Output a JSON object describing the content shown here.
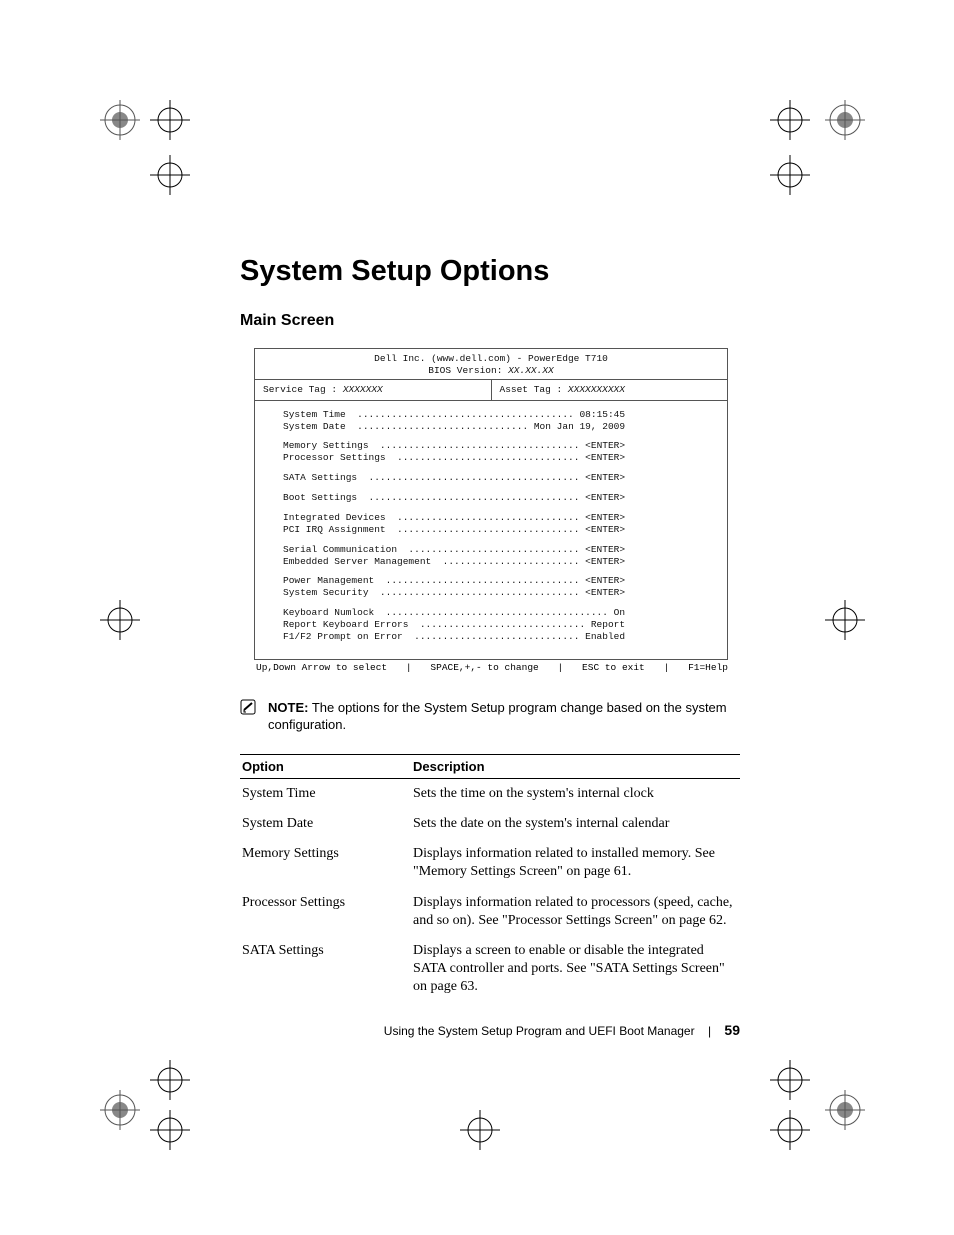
{
  "heading": "System Setup Options",
  "subheading": "Main Screen",
  "bios": {
    "header_line1": "Dell Inc. (www.dell.com) - PowerEdge T710",
    "header_line2_pre": "BIOS Version: ",
    "header_line2_ital": "XX.XX.XX",
    "service_tag_label": "Service Tag : ",
    "service_tag_value": "XXXXXXX",
    "asset_tag_label": "Asset Tag : ",
    "asset_tag_value": "XXXXXXXXXX",
    "groups": [
      [
        {
          "label": "System Time",
          "value": "08:15:45"
        },
        {
          "label": "System Date",
          "value": "Mon Jan 19, 2009"
        }
      ],
      [
        {
          "label": "Memory Settings",
          "value": "<ENTER>"
        },
        {
          "label": "Processor Settings",
          "value": "<ENTER>"
        }
      ],
      [
        {
          "label": "SATA Settings",
          "value": "<ENTER>"
        }
      ],
      [
        {
          "label": "Boot Settings",
          "value": "<ENTER>"
        }
      ],
      [
        {
          "label": "Integrated Devices",
          "value": "<ENTER>"
        },
        {
          "label": "PCI IRQ Assignment",
          "value": "<ENTER>"
        }
      ],
      [
        {
          "label": "Serial Communication",
          "value": "<ENTER>"
        },
        {
          "label": "Embedded Server Management",
          "value": "<ENTER>"
        }
      ],
      [
        {
          "label": "Power Management",
          "value": "<ENTER>"
        },
        {
          "label": "System Security",
          "value": "<ENTER>"
        }
      ],
      [
        {
          "label": "Keyboard Numlock",
          "value": "On"
        },
        {
          "label": "Report Keyboard Errors",
          "value": "Report"
        },
        {
          "label": "F1/F2 Prompt on Error",
          "value": "Enabled"
        }
      ]
    ],
    "footer": {
      "a": "Up,Down Arrow to select",
      "b": "SPACE,+,- to change",
      "c": "ESC to exit",
      "d": "F1=Help"
    }
  },
  "note": {
    "label": "NOTE:",
    "text": " The options for the System Setup program change based on the system configuration."
  },
  "table": {
    "col_option": "Option",
    "col_description": "Description",
    "rows": [
      {
        "option": "System Time",
        "description": "Sets the time on the system's internal clock"
      },
      {
        "option": "System Date",
        "description": "Sets the date on the system's internal calendar"
      },
      {
        "option": "Memory Settings",
        "description": "Displays information related to installed memory. See \"Memory Settings Screen\" on page 61."
      },
      {
        "option": "Processor Settings",
        "description": "Displays information related to processors (speed, cache, and so on). See \"Processor Settings Screen\" on page 62."
      },
      {
        "option": "SATA Settings",
        "description": "Displays a screen to enable or disable the integrated SATA controller and ports. See \"SATA Settings Screen\" on page 63."
      }
    ]
  },
  "footer": {
    "chapter": "Using the System Setup Program and UEFI Boot Manager",
    "page": "59"
  }
}
